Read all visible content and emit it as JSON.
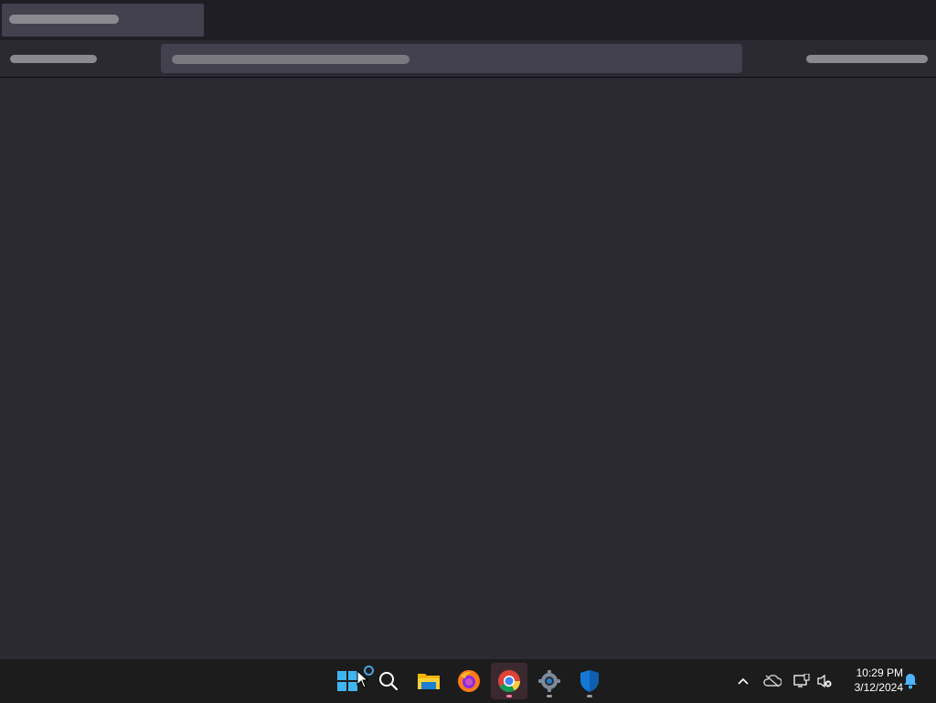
{
  "browser": {
    "state": "loading",
    "tab_title": "",
    "url": ""
  },
  "taskbar": {
    "apps": [
      {
        "name": "start",
        "icon": "windows-logo-icon"
      },
      {
        "name": "search",
        "icon": "search-icon"
      },
      {
        "name": "file-explorer",
        "icon": "folder-icon"
      },
      {
        "name": "firefox",
        "icon": "firefox-icon"
      },
      {
        "name": "chrome",
        "icon": "chrome-icon",
        "active": true
      },
      {
        "name": "settings",
        "icon": "gear-icon"
      },
      {
        "name": "windows-security",
        "icon": "shield-icon"
      }
    ],
    "tray": {
      "icons": [
        "chevron-up-icon",
        "onedrive-offline-icon",
        "network-icon",
        "volume-muted-icon"
      ],
      "time": "10:29 PM",
      "date": "3/12/2024"
    }
  },
  "colors": {
    "page_bg": "#2b2a33",
    "tabstrip_bg": "#1f1e25",
    "taskbar_bg": "#1c1c1c",
    "accent": "#4aa3df"
  }
}
